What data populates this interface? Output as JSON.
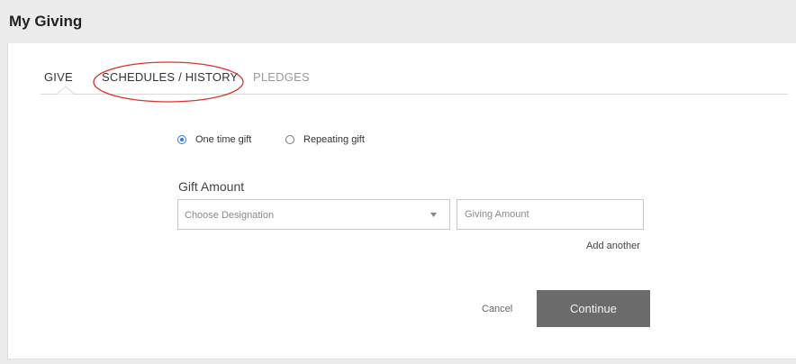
{
  "header": {
    "title": "My Giving"
  },
  "tabs": [
    {
      "label": "GIVE",
      "active": true
    },
    {
      "label": "SCHEDULES / HISTORY",
      "active": false,
      "annotated": true
    },
    {
      "label": "PLEDGES",
      "active": false
    }
  ],
  "gift_type": {
    "options": [
      {
        "label": "One time gift",
        "selected": true
      },
      {
        "label": "Repeating gift",
        "selected": false
      }
    ]
  },
  "gift_amount": {
    "label": "Gift Amount",
    "designation_placeholder": "Choose Designation",
    "amount_placeholder": "Giving Amount",
    "add_another_label": "Add another"
  },
  "actions": {
    "cancel_label": "Cancel",
    "continue_label": "Continue"
  },
  "colors": {
    "radio_accent": "#2a7de1",
    "annotation": "#d9352b",
    "continue_bg": "#6b6b6b"
  }
}
